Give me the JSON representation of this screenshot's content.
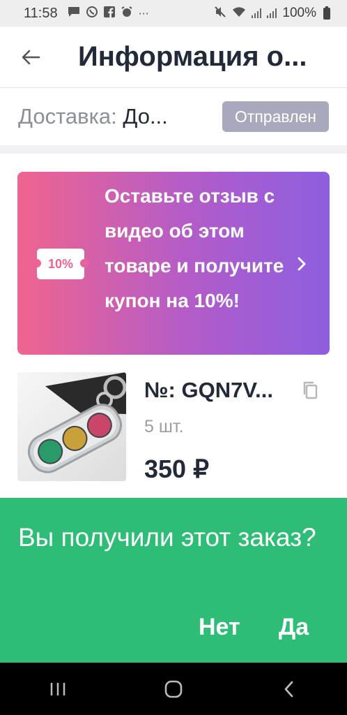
{
  "status_bar": {
    "time": "11:58",
    "battery": "100%",
    "left_icons": [
      "message-icon",
      "whatsapp-icon",
      "facebook-icon",
      "alarm-icon",
      "more-dots-icon"
    ],
    "right_icons": [
      "mute-icon",
      "wifi-icon",
      "signal-icon",
      "signal-icon",
      "battery-icon"
    ]
  },
  "header": {
    "title": "Информация о..."
  },
  "delivery": {
    "label": "Доставка: ",
    "value": "До...",
    "status": "Отправлен",
    "status_color": "#a8a9bc"
  },
  "promo": {
    "coupon": "10%",
    "text": "Оставьте отзыв с видео об этом товаре и получите купон на 10%!",
    "gradient": [
      "#f0648f",
      "#8d5ee0"
    ]
  },
  "product": {
    "order_number": "№: GQN7V...",
    "quantity": "5 шт.",
    "price": "350 ₽"
  },
  "confirm": {
    "question": "Вы получили этот заказ?",
    "no": "Нет",
    "yes": "Да",
    "bg_color": "#2dbd77"
  },
  "nav": {
    "buttons": [
      "recent-apps-icon",
      "home-icon",
      "back-icon"
    ]
  }
}
